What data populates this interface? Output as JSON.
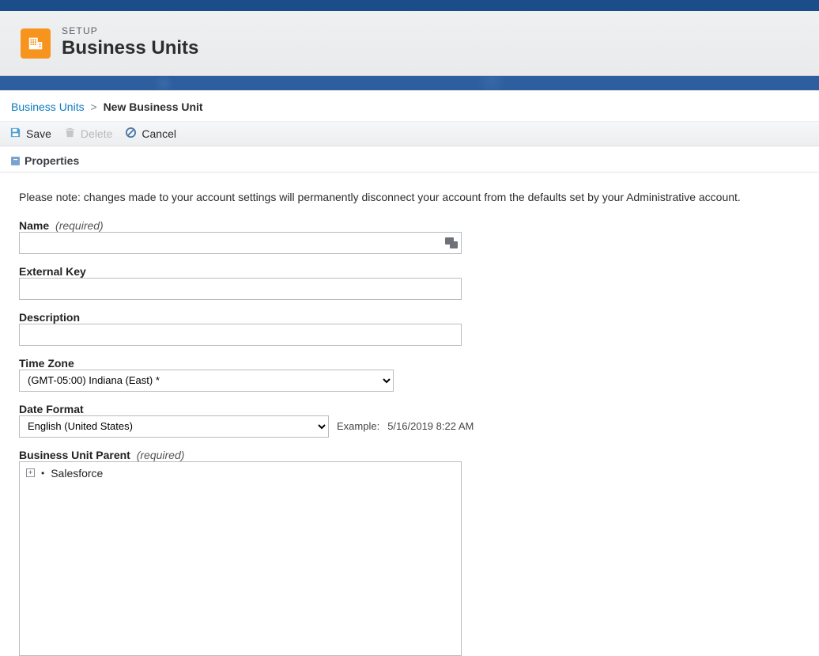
{
  "header": {
    "eyebrow": "SETUP",
    "title": "Business Units"
  },
  "breadcrumb": {
    "root": "Business Units",
    "separator": ">",
    "current": "New Business Unit"
  },
  "toolbar": {
    "save": "Save",
    "delete": "Delete",
    "cancel": "Cancel"
  },
  "section": {
    "properties_title": "Properties",
    "note": "Please note: changes made to your account settings will permanently disconnect your account from the defaults set by your Administrative account."
  },
  "fields": {
    "name": {
      "label": "Name",
      "required": "(required)",
      "value": ""
    },
    "external_key": {
      "label": "External Key",
      "value": ""
    },
    "description": {
      "label": "Description",
      "value": ""
    },
    "time_zone": {
      "label": "Time Zone",
      "selected": "(GMT-05:00) Indiana (East) *"
    },
    "date_format": {
      "label": "Date Format",
      "selected": "English (United States)",
      "example_label": "Example:",
      "example_value": "5/16/2019 8:22 AM"
    },
    "parent": {
      "label": "Business Unit Parent",
      "required": "(required)",
      "root_label": "Salesforce"
    }
  }
}
